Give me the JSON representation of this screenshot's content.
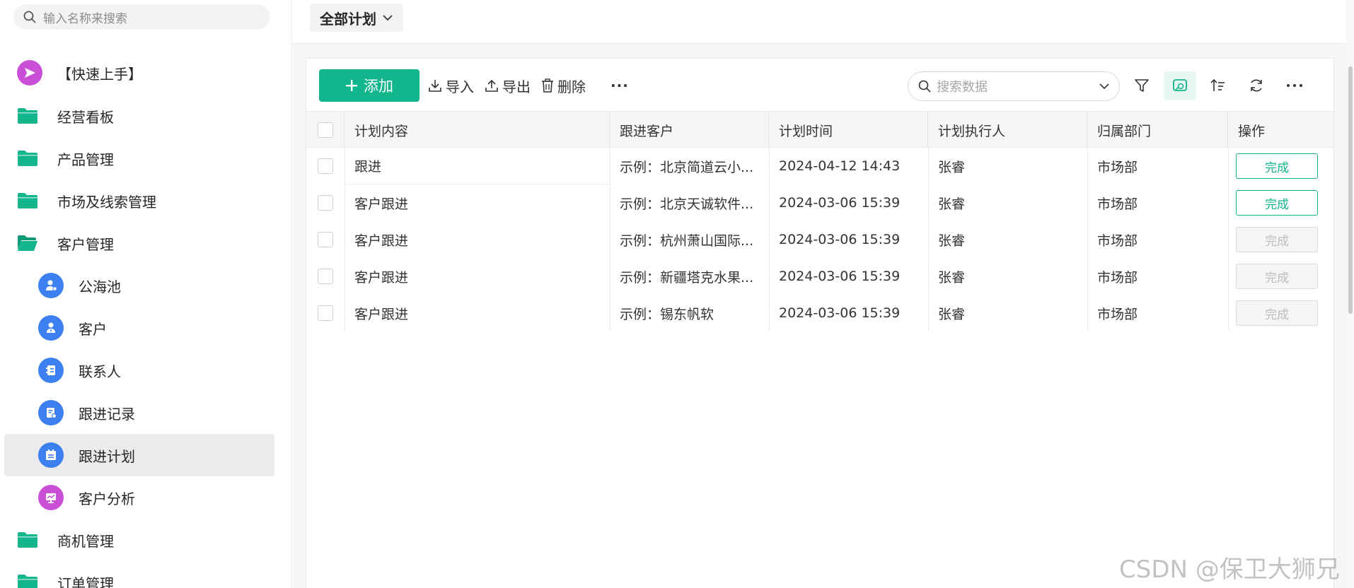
{
  "sidebar": {
    "search_placeholder": "输入名称来搜索",
    "items": [
      {
        "label": "【快速上手】",
        "icon": "send-icon",
        "color": "#c94fd6"
      },
      {
        "label": "经营看板",
        "icon": "folder-icon",
        "color": "#13b58c"
      },
      {
        "label": "产品管理",
        "icon": "folder-icon",
        "color": "#13b58c"
      },
      {
        "label": "市场及线索管理",
        "icon": "folder-icon",
        "color": "#13b58c"
      },
      {
        "label": "客户管理",
        "icon": "folder-open-icon",
        "color": "#13b58c"
      },
      {
        "label": "公海池",
        "icon": "user-pool-icon",
        "color": "#3b7ff0"
      },
      {
        "label": "客户",
        "icon": "user-icon",
        "color": "#3b7ff0"
      },
      {
        "label": "联系人",
        "icon": "contact-card-icon",
        "color": "#3b7ff0"
      },
      {
        "label": "跟进记录",
        "icon": "record-icon",
        "color": "#3b7ff0"
      },
      {
        "label": "跟进计划",
        "icon": "plan-icon",
        "color": "#3b7ff0"
      },
      {
        "label": "客户分析",
        "icon": "analytics-icon",
        "color": "#c94fd6"
      },
      {
        "label": "商机管理",
        "icon": "folder-icon",
        "color": "#13b58c"
      },
      {
        "label": "订单管理",
        "icon": "folder-icon",
        "color": "#13b58c"
      }
    ]
  },
  "header": {
    "view_select": "全部计划"
  },
  "toolbar": {
    "add_label": "添加",
    "import_label": "导入",
    "export_label": "导出",
    "delete_label": "删除",
    "more_label": "···",
    "search_placeholder": "搜索数据"
  },
  "table": {
    "columns": [
      "计划内容",
      "跟进客户",
      "计划时间",
      "计划执行人",
      "归属部门",
      "操作"
    ],
    "rows": [
      {
        "content": "跟进",
        "customer": "示例：北京简道云小...",
        "time": "2024-04-12 14:43",
        "executor": "张睿",
        "dept": "市场部",
        "action": "完成",
        "enabled": true
      },
      {
        "content": "客户跟进",
        "customer": "示例：北京天诚软件...",
        "time": "2024-03-06 15:39",
        "executor": "张睿",
        "dept": "市场部",
        "action": "完成",
        "enabled": true
      },
      {
        "content": "客户跟进",
        "customer": "示例：杭州萧山国际...",
        "time": "2024-03-06 15:39",
        "executor": "张睿",
        "dept": "市场部",
        "action": "完成",
        "enabled": false
      },
      {
        "content": "客户跟进",
        "customer": "示例：新疆塔克水果...",
        "time": "2024-03-06 15:39",
        "executor": "张睿",
        "dept": "市场部",
        "action": "完成",
        "enabled": false
      },
      {
        "content": "客户跟进",
        "customer": "示例：锡东帆软",
        "time": "2024-03-06 15:39",
        "executor": "张睿",
        "dept": "市场部",
        "action": "完成",
        "enabled": false
      }
    ]
  },
  "watermark": "CSDN @保卫大狮兄",
  "colors": {
    "accent": "#13b58c",
    "active_bg": "#ebebed",
    "blue": "#3b7ff0",
    "purple": "#c94fd6"
  }
}
